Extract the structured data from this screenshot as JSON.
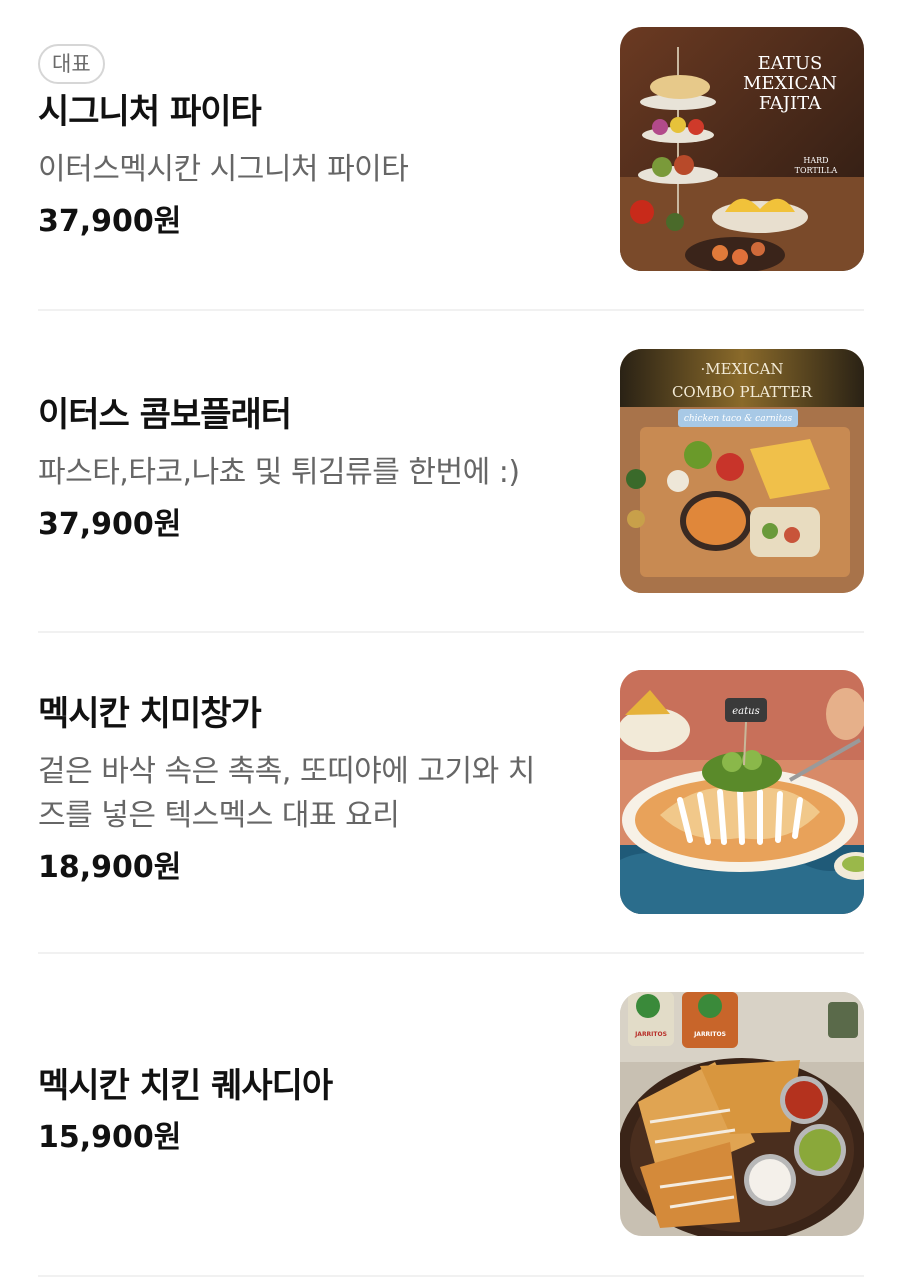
{
  "items": [
    {
      "badge": "대표",
      "name": "시그니처 파이타",
      "desc_lines": [
        "이터스멕시칸 시그니처 파이타"
      ],
      "price": "37,900원",
      "image_text": [
        "EATUS",
        "MEXICAN",
        "FAJITA",
        "HARD",
        "TORTILLA"
      ]
    },
    {
      "name": "이터스 콤보플래터",
      "desc_lines": [
        "파스타,타코,나쵸 및 튀김류를 한번에 :)"
      ],
      "price": "37,900원",
      "image_text": [
        "·MEXICAN",
        "COMBO PLATTER",
        "chicken taco & carnitas"
      ]
    },
    {
      "name": "멕시칸 치미창가",
      "desc_lines": [
        "겉은 바삭 속은 촉촉, 또띠야에 고기와 치",
        "즈를 넣은 텍스멕스 대표 요리"
      ],
      "price": "18,900원",
      "image_text": [
        "eatus"
      ]
    },
    {
      "name": "멕시칸 치킨 퀘사디아",
      "price": "15,900원",
      "image_text": [
        "JARRITOS",
        "JARRITOS"
      ]
    }
  ]
}
